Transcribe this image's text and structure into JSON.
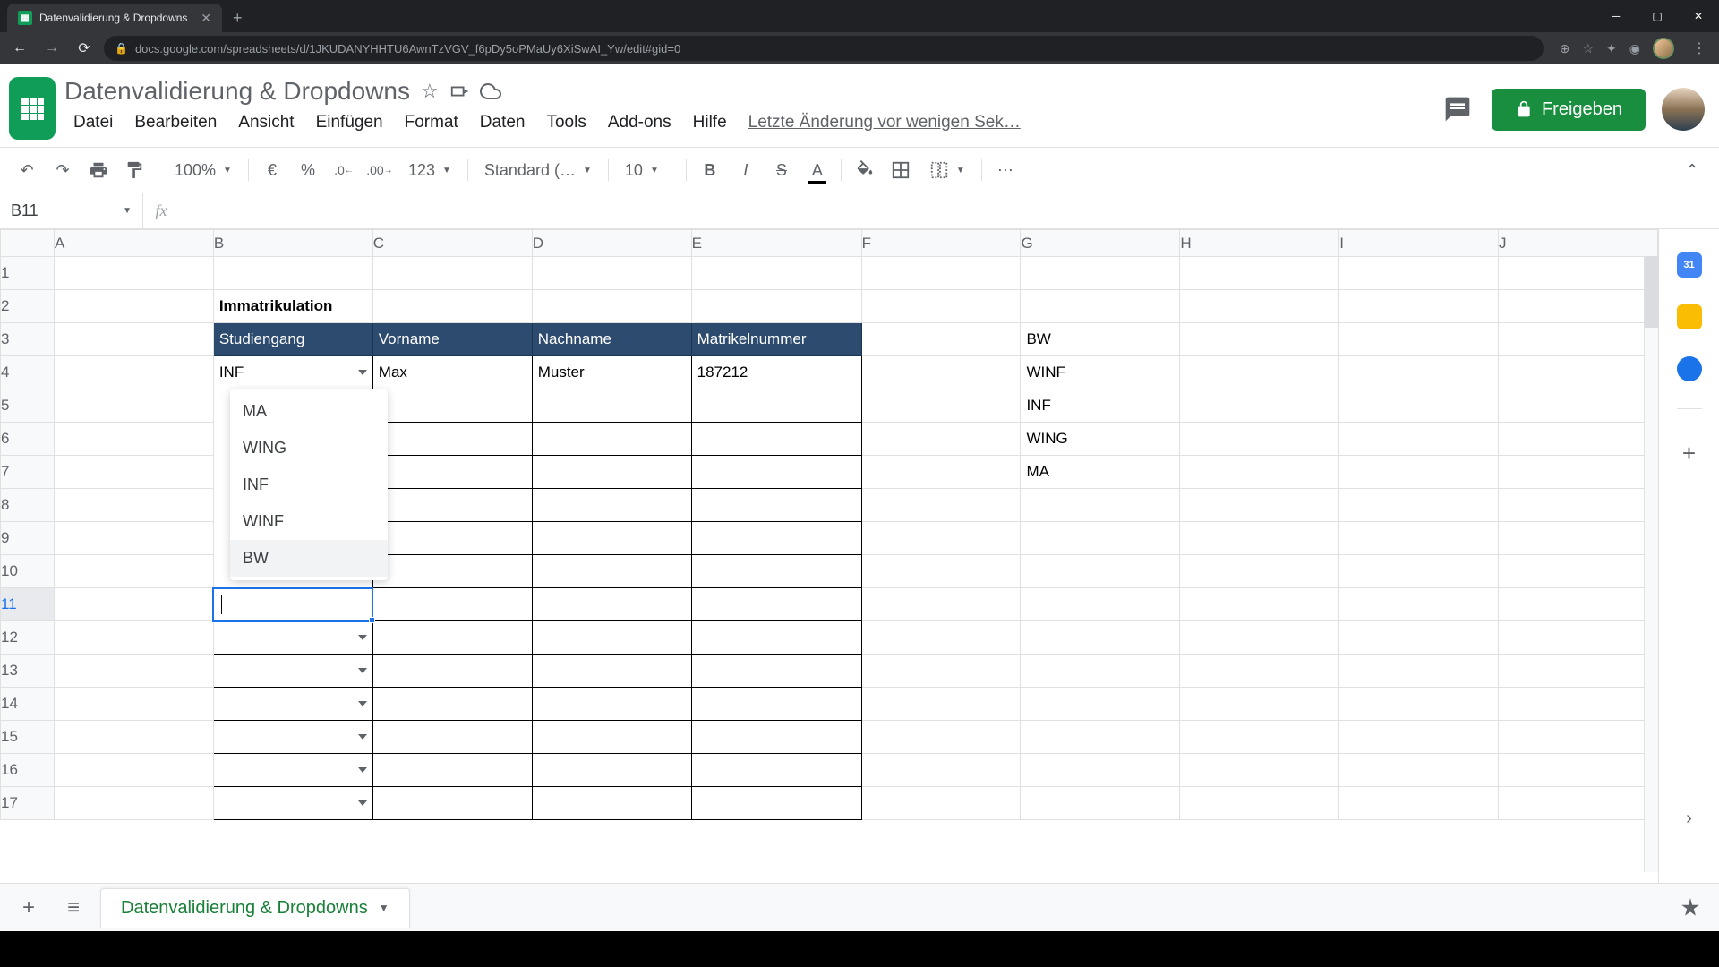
{
  "browser": {
    "tab_title": "Datenvalidierung & Dropdowns",
    "url": "docs.google.com/spreadsheets/d/1JKUDANYHHTU6AwnTzVGV_f6pDy5oPMaUy6XiSwAI_Yw/edit#gid=0"
  },
  "doc": {
    "title": "Datenvalidierung & Dropdowns",
    "last_edit": "Letzte Änderung vor wenigen Sek…"
  },
  "menus": {
    "file": "Datei",
    "edit": "Bearbeiten",
    "view": "Ansicht",
    "insert": "Einfügen",
    "format": "Format",
    "data": "Daten",
    "tools": "Tools",
    "addons": "Add-ons",
    "help": "Hilfe"
  },
  "share": {
    "label": "Freigeben"
  },
  "toolbar": {
    "zoom": "100%",
    "currency": "€",
    "percent": "%",
    "dec_less": ".0",
    "dec_more": ".00",
    "numfmt": "123",
    "font": "Standard (…",
    "size": "10"
  },
  "namebox": "B11",
  "columns": [
    "A",
    "B",
    "C",
    "D",
    "E",
    "F",
    "G",
    "H",
    "I",
    "J"
  ],
  "spreadsheet": {
    "B2": "Immatrikulation",
    "headers": {
      "B3": "Studiengang",
      "C3": "Vorname",
      "D3": "Nachname",
      "E3": "Matrikelnummer"
    },
    "B4": "INF",
    "C4": "Max",
    "D4": "Muster",
    "E4": "187212",
    "G3": "BW",
    "G4": "WINF",
    "G5": "INF",
    "G6": "WING",
    "G7": "MA"
  },
  "dropdown": {
    "items": [
      "MA",
      "WING",
      "INF",
      "WINF",
      "BW"
    ]
  },
  "sheet_tab": "Datenvalidierung & Dropdowns"
}
